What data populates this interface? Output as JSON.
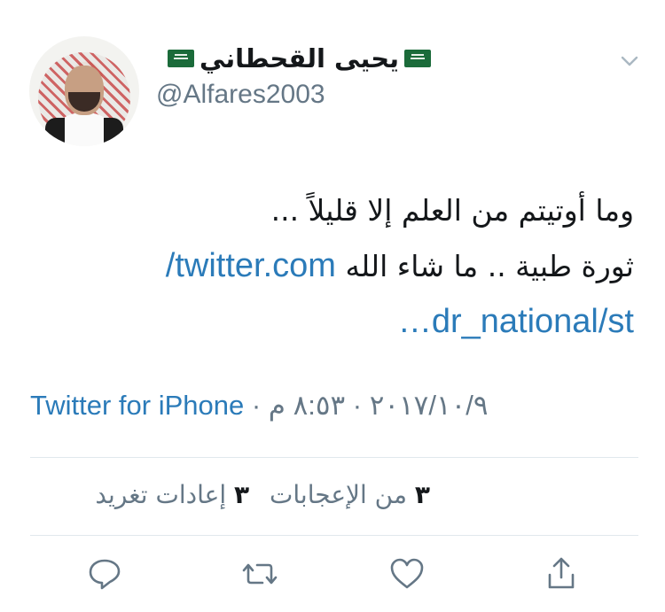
{
  "tweet": {
    "display_name": "يحيى القحطاني",
    "handle": "@Alfares2003",
    "text_line1": "وما أوتيتم من العلم إلا قليلاً ...",
    "text_line2_ar": "ثورة طبية .. ما شاء الله",
    "link_part1": "twitter.com/",
    "link_part2": "dr_national/st…",
    "source": "Twitter for iPhone",
    "separator": " · ",
    "timestamp": "٢٠١٧/١٠/٩ · ٨:٥٣ م",
    "likes_count": "٣",
    "likes_label": "من الإعجابات",
    "retweets_count": "٣",
    "retweets_label": "إعادات تغريد"
  },
  "icons": {
    "flag": "saudi-flag-icon",
    "menu": "chevron-down-icon",
    "reply": "reply-icon",
    "retweet": "retweet-icon",
    "like": "heart-icon",
    "share": "share-icon"
  },
  "colors": {
    "link": "#2b7bb9",
    "secondary_text": "#657786",
    "divider": "#e1e8ed",
    "flag_green": "#1b6b3a"
  }
}
